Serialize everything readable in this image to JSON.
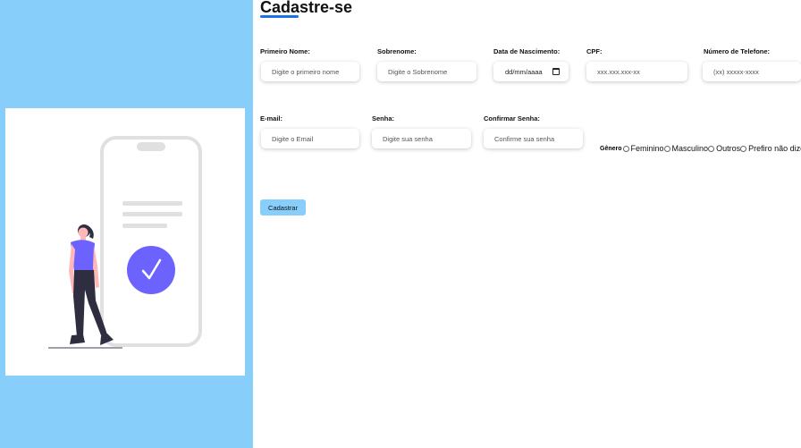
{
  "page": {
    "title": "Cadastre-se"
  },
  "form": {
    "first_name": {
      "label": "Primeiro Nome:",
      "placeholder": "Digite o primeiro nome"
    },
    "last_name": {
      "label": "Sobrenome:",
      "placeholder": "Digite o Sobrenome"
    },
    "birth_date": {
      "label": "Data de Nascimento:",
      "value": "dd/mm/aaaa"
    },
    "cpf": {
      "label": "CPF:",
      "placeholder": "xxx.xxx.xxx-xx"
    },
    "phone": {
      "label": "Número de Telefone:",
      "placeholder": "(xx) xxxxx-xxxx"
    },
    "email": {
      "label": "E-mail:",
      "placeholder": "Digite o Email"
    },
    "password": {
      "label": "Senha:",
      "placeholder": "Digite sua senha"
    },
    "confirm_password": {
      "label": "Confirmar Senha:",
      "placeholder": "Confirme sua senha"
    },
    "gender": {
      "label": "Gênero",
      "options": [
        "Feminino",
        "Masculino",
        "Outros",
        "Prefiro não dizer"
      ]
    },
    "submit_label": "Cadastrar"
  },
  "colors": {
    "panel_bg": "#87cefa",
    "accent": "#1a73e8",
    "illustration_purple": "#6c63ff",
    "phone_outline": "#e0e0e0"
  },
  "icons": [
    "phone-mockup-icon",
    "checkmark-icon",
    "person-icon",
    "calendar-icon"
  ]
}
